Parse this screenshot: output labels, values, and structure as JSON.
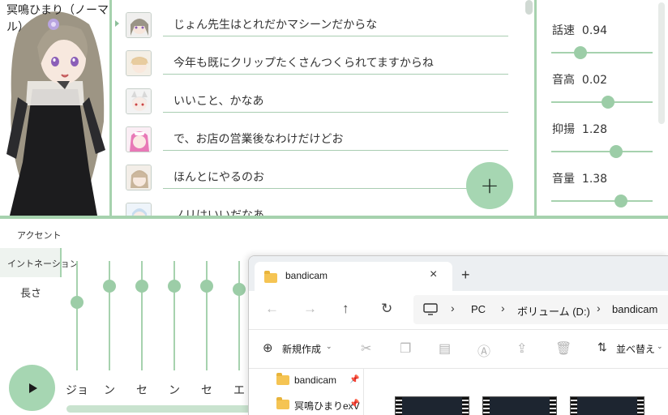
{
  "character": {
    "name": "冥鳴ひまり（ノーマル）"
  },
  "dialog": {
    "lines": [
      {
        "text": "じょん先生はとれだかマシーンだからな",
        "avatar": "silver-haired-girl-avatar"
      },
      {
        "text": "今年も既にクリップたくさんつくられてますからね",
        "avatar": "blonde-boy-avatar"
      },
      {
        "text": "いいこと、かなあ",
        "avatar": "white-wolf-girl-avatar"
      },
      {
        "text": "で、お店の営業後なわけだけどお",
        "avatar": "pink-maid-girl-avatar"
      },
      {
        "text": "ほんとにやるのお",
        "avatar": "brown-haired-girl-avatar"
      },
      {
        "text": "ノリはいいだなあ",
        "avatar": "light-blue-girl-avatar"
      }
    ],
    "add_label": "+"
  },
  "params": [
    {
      "label": "話速",
      "value": "0.94",
      "level": 0.29
    },
    {
      "label": "音高",
      "value": "0.02",
      "level": 0.56
    },
    {
      "label": "抑揚",
      "value": "1.28",
      "level": 0.64
    },
    {
      "label": "音量",
      "value": "1.38",
      "level": 0.69
    }
  ],
  "tabs": {
    "accent": "アクセント",
    "intonation": "イントネーション",
    "length": "長さ"
  },
  "intonation": {
    "sliders": [
      {
        "mora": "ジョ",
        "level": 0.62
      },
      {
        "mora": "ン",
        "level": 0.77
      },
      {
        "mora": "セ",
        "level": 0.77
      },
      {
        "mora": "ン",
        "level": 0.77
      },
      {
        "mora": "セ",
        "level": 0.77
      },
      {
        "mora": "エ",
        "level": 0.74
      }
    ]
  },
  "explorer": {
    "tab_title": "bandicam",
    "tab_close": "×",
    "new_tab": "+",
    "breadcrumbs": [
      "PC",
      "ボリューム (D:)",
      "bandicam"
    ],
    "new_button": "新規作成",
    "sort_button": "並べ替え",
    "sidebar": [
      {
        "label": "bandicam"
      },
      {
        "label": "冥鳴ひまりexV"
      }
    ]
  },
  "colors": {
    "accent": "#a6d2ae",
    "knob": "#9ccda7",
    "button": "#a6d6b2"
  }
}
